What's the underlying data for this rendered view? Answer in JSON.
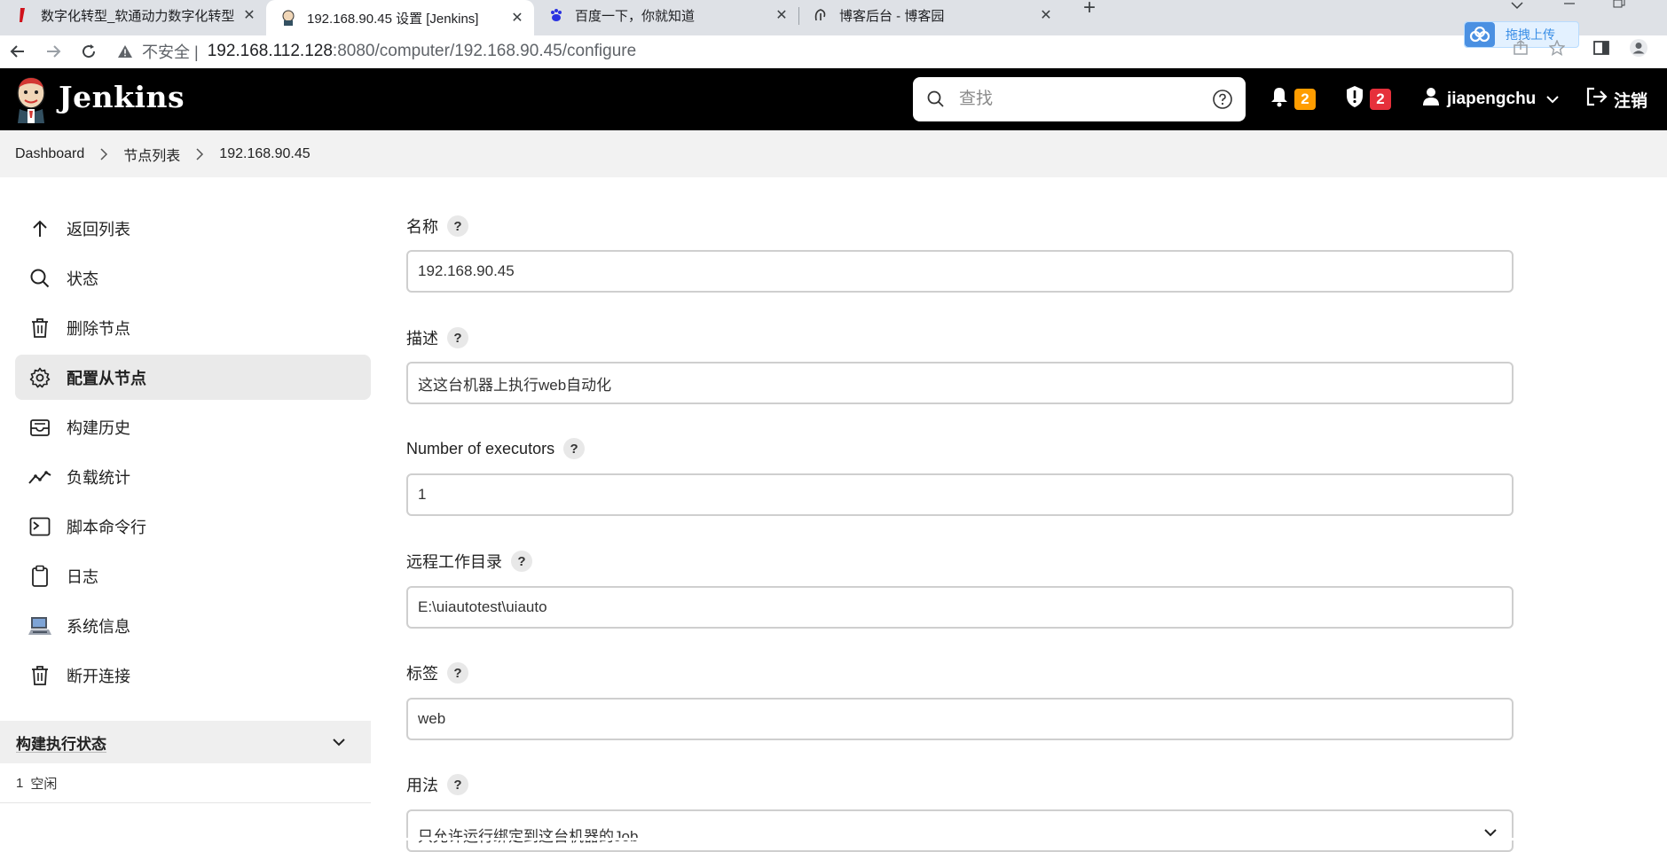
{
  "browser": {
    "tabs": [
      {
        "title": "数字化转型_软通动力数字化转型"
      },
      {
        "title": "192.168.90.45 设置 [Jenkins]"
      },
      {
        "title": "百度一下，你就知道"
      },
      {
        "title": "博客后台 - 博客园"
      }
    ],
    "insecure_label": "不安全",
    "url_host": "192.168.112.128",
    "url_path": ":8080/computer/192.168.90.45/configure",
    "upload_label": "拖拽上传"
  },
  "header": {
    "title": "Jenkins",
    "search_placeholder": "查找",
    "notifications_count": "2",
    "security_count": "2",
    "username": "jiapengchu",
    "logout_label": "注销",
    "colors": {
      "notif_badge": "#ff9d00",
      "security_badge": "#e6303b"
    }
  },
  "breadcrumb": {
    "items": [
      "Dashboard",
      "节点列表",
      "192.168.90.45"
    ]
  },
  "sidebar": {
    "items": [
      {
        "label": "返回列表",
        "icon": "arrow-up-icon"
      },
      {
        "label": "状态",
        "icon": "search-icon"
      },
      {
        "label": "删除节点",
        "icon": "trash-icon"
      },
      {
        "label": "配置从节点",
        "icon": "gear-icon"
      },
      {
        "label": "构建历史",
        "icon": "inbox-icon"
      },
      {
        "label": "负载统计",
        "icon": "trend-icon"
      },
      {
        "label": "脚本命令行",
        "icon": "terminal-icon"
      },
      {
        "label": "日志",
        "icon": "clipboard-icon"
      },
      {
        "label": "系统信息",
        "icon": "computer-icon"
      },
      {
        "label": "断开连接",
        "icon": "trash-icon"
      }
    ],
    "executor_status": {
      "title": "构建执行状态",
      "rows": [
        {
          "index": "1",
          "status": "空闲"
        }
      ]
    }
  },
  "form": {
    "name": {
      "label": "名称",
      "value": "192.168.90.45"
    },
    "description": {
      "label": "描述",
      "value": "这这台机器上执行web自动化"
    },
    "executors": {
      "label": "Number of executors",
      "value": "1"
    },
    "remote_dir": {
      "label": "远程工作目录",
      "value": "E:\\uiautotest\\uiauto"
    },
    "labels": {
      "label": "标签",
      "value": "web"
    },
    "usage": {
      "label": "用法",
      "value": "只允许运行绑定到这台机器的Job"
    }
  }
}
